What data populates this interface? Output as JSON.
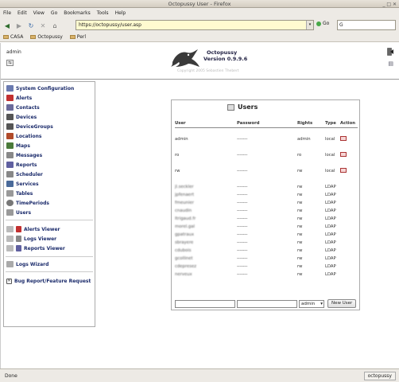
{
  "window": {
    "title": "Octopussy User - Firefox"
  },
  "menu": [
    "File",
    "Edit",
    "View",
    "Go",
    "Bookmarks",
    "Tools",
    "Help"
  ],
  "nav": {
    "url": "https://octopussy/user.asp",
    "go_label": "Go",
    "search_placeholder": "G"
  },
  "bookmarks": [
    "CASA",
    "Octopussy",
    "Perl"
  ],
  "header": {
    "username": "admin",
    "app_name": "Octopussy",
    "version": "Version 0.9.9.6",
    "copyright": "Copyright 2005 Sebastien Thebert"
  },
  "sidebar": {
    "main": [
      {
        "label": "System Configuration",
        "icon": "wrench-icon",
        "color": "#6a7ab0"
      },
      {
        "label": "Alerts",
        "icon": "alert-icon",
        "color": "#c23030"
      },
      {
        "label": "Contacts",
        "icon": "contacts-icon",
        "color": "#6a6a9a"
      },
      {
        "label": "Devices",
        "icon": "device-icon",
        "color": "#555555"
      },
      {
        "label": "DeviceGroups",
        "icon": "device-group-icon",
        "color": "#555555"
      },
      {
        "label": "Locations",
        "icon": "location-icon",
        "color": "#b04a2a"
      },
      {
        "label": "Maps",
        "icon": "map-icon",
        "color": "#4a7a3a"
      },
      {
        "label": "Messages",
        "icon": "messages-icon",
        "color": "#888888"
      },
      {
        "label": "Reports",
        "icon": "report-icon",
        "color": "#6060a0"
      },
      {
        "label": "Scheduler",
        "icon": "scheduler-icon",
        "color": "#888888"
      },
      {
        "label": "Services",
        "icon": "services-icon",
        "color": "#4a6a9a"
      },
      {
        "label": "Tables",
        "icon": "table-icon",
        "color": "#999999"
      },
      {
        "label": "TimePeriods",
        "icon": "clock-icon",
        "color": "#777777"
      },
      {
        "label": "Users",
        "icon": "users-icon",
        "color": "#999999"
      }
    ],
    "viewers": [
      {
        "label": "Alerts Viewer",
        "icon": "alert-viewer-icon"
      },
      {
        "label": "Logs Viewer",
        "icon": "logs-viewer-icon"
      },
      {
        "label": "Reports Viewer",
        "icon": "reports-viewer-icon"
      }
    ],
    "wizard": {
      "label": "Logs Wizard"
    },
    "bug": {
      "label": "Bug Report/Feature Request"
    }
  },
  "users_panel": {
    "title": "Users",
    "columns": [
      "User",
      "Password",
      "Rights",
      "Type",
      "Action"
    ],
    "rows": [
      {
        "user": "admin",
        "password": "-------",
        "rights": "admin",
        "type": "local",
        "action": true
      },
      {
        "user": "ro",
        "password": "-------",
        "rights": "ro",
        "type": "local",
        "action": true
      },
      {
        "user": "rw",
        "password": "-------",
        "rights": "rw",
        "type": "local",
        "action": true
      }
    ],
    "ldap_rows": [
      {
        "user": "jl.seckler",
        "password": "-------",
        "rights": "rw",
        "type": "LDAP"
      },
      {
        "user": "jpfenaert",
        "password": "-------",
        "rights": "rw",
        "type": "LDAP"
      },
      {
        "user": "fmeunier",
        "password": "-------",
        "rights": "rw",
        "type": "LDAP"
      },
      {
        "user": "cnaudin",
        "password": "-------",
        "rights": "rw",
        "type": "LDAP"
      },
      {
        "user": "ltrigaud.fr",
        "password": "-------",
        "rights": "rw",
        "type": "LDAP"
      },
      {
        "user": "morel.gal",
        "password": "-------",
        "rights": "rw",
        "type": "LDAP"
      },
      {
        "user": "gpatraux",
        "password": "-------",
        "rights": "rw",
        "type": "LDAP"
      },
      {
        "user": "sbrayere",
        "password": "-------",
        "rights": "rw",
        "type": "LDAP"
      },
      {
        "user": "cdubois",
        "password": "-------",
        "rights": "rw",
        "type": "LDAP"
      },
      {
        "user": "gcollinet",
        "password": "-------",
        "rights": "rw",
        "type": "LDAP"
      },
      {
        "user": "cdepresez",
        "password": "-------",
        "rights": "rw",
        "type": "LDAP"
      },
      {
        "user": "nerveux",
        "password": "-------",
        "rights": "rw",
        "type": "LDAP"
      }
    ],
    "new_user": {
      "rights_selected": "admin",
      "button_label": "New User"
    }
  },
  "status": {
    "left": "Done",
    "right": "octopussy"
  },
  "colors": {
    "link": "#1b2b6b",
    "urlbar": "#fffbd0",
    "chrome": "#edeae5"
  }
}
